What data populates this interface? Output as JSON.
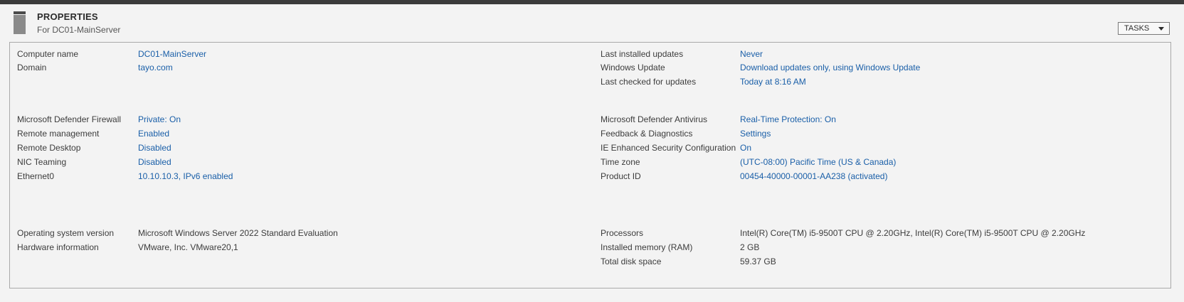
{
  "header": {
    "title": "PROPERTIES",
    "subtitle": "For DC01-MainServer",
    "tasks_label": "TASKS"
  },
  "properties": {
    "computer_name": {
      "label": "Computer name",
      "value": "DC01-MainServer"
    },
    "domain": {
      "label": "Domain",
      "value": "tayo.com"
    },
    "last_installed_updates": {
      "label": "Last installed updates",
      "value": "Never"
    },
    "windows_update": {
      "label": "Windows Update",
      "value": "Download updates only, using Windows Update"
    },
    "last_checked": {
      "label": "Last checked for updates",
      "value": "Today at 8:16 AM"
    },
    "firewall": {
      "label": "Microsoft Defender Firewall",
      "value": "Private: On"
    },
    "remote_management": {
      "label": "Remote management",
      "value": "Enabled"
    },
    "remote_desktop": {
      "label": "Remote Desktop",
      "value": "Disabled"
    },
    "nic_teaming": {
      "label": "NIC Teaming",
      "value": "Disabled"
    },
    "ethernet0": {
      "label": "Ethernet0",
      "value": "10.10.10.3, IPv6 enabled"
    },
    "antivirus": {
      "label": "Microsoft Defender Antivirus",
      "value": "Real-Time Protection: On"
    },
    "feedback": {
      "label": "Feedback & Diagnostics",
      "value": "Settings"
    },
    "ie_esc": {
      "label": "IE Enhanced Security Configuration",
      "value": "On"
    },
    "time_zone": {
      "label": "Time zone",
      "value": "(UTC-08:00) Pacific Time (US & Canada)"
    },
    "product_id": {
      "label": "Product ID",
      "value": "00454-40000-00001-AA238 (activated)"
    },
    "os_version": {
      "label": "Operating system version",
      "value": "Microsoft Windows Server 2022 Standard Evaluation"
    },
    "hardware": {
      "label": "Hardware information",
      "value": "VMware, Inc. VMware20,1"
    },
    "processors": {
      "label": "Processors",
      "value": "Intel(R) Core(TM) i5-9500T CPU @ 2.20GHz, Intel(R) Core(TM) i5-9500T CPU @ 2.20GHz"
    },
    "memory": {
      "label": "Installed memory (RAM)",
      "value": "2 GB"
    },
    "disk": {
      "label": "Total disk space",
      "value": "59.37 GB"
    }
  },
  "colors": {
    "link": "#1a5fa8",
    "text": "#3c3c3c",
    "background": "#f3f3f3"
  },
  "icons": {
    "header": "server-icon",
    "tasks": "chevron-down-icon"
  }
}
